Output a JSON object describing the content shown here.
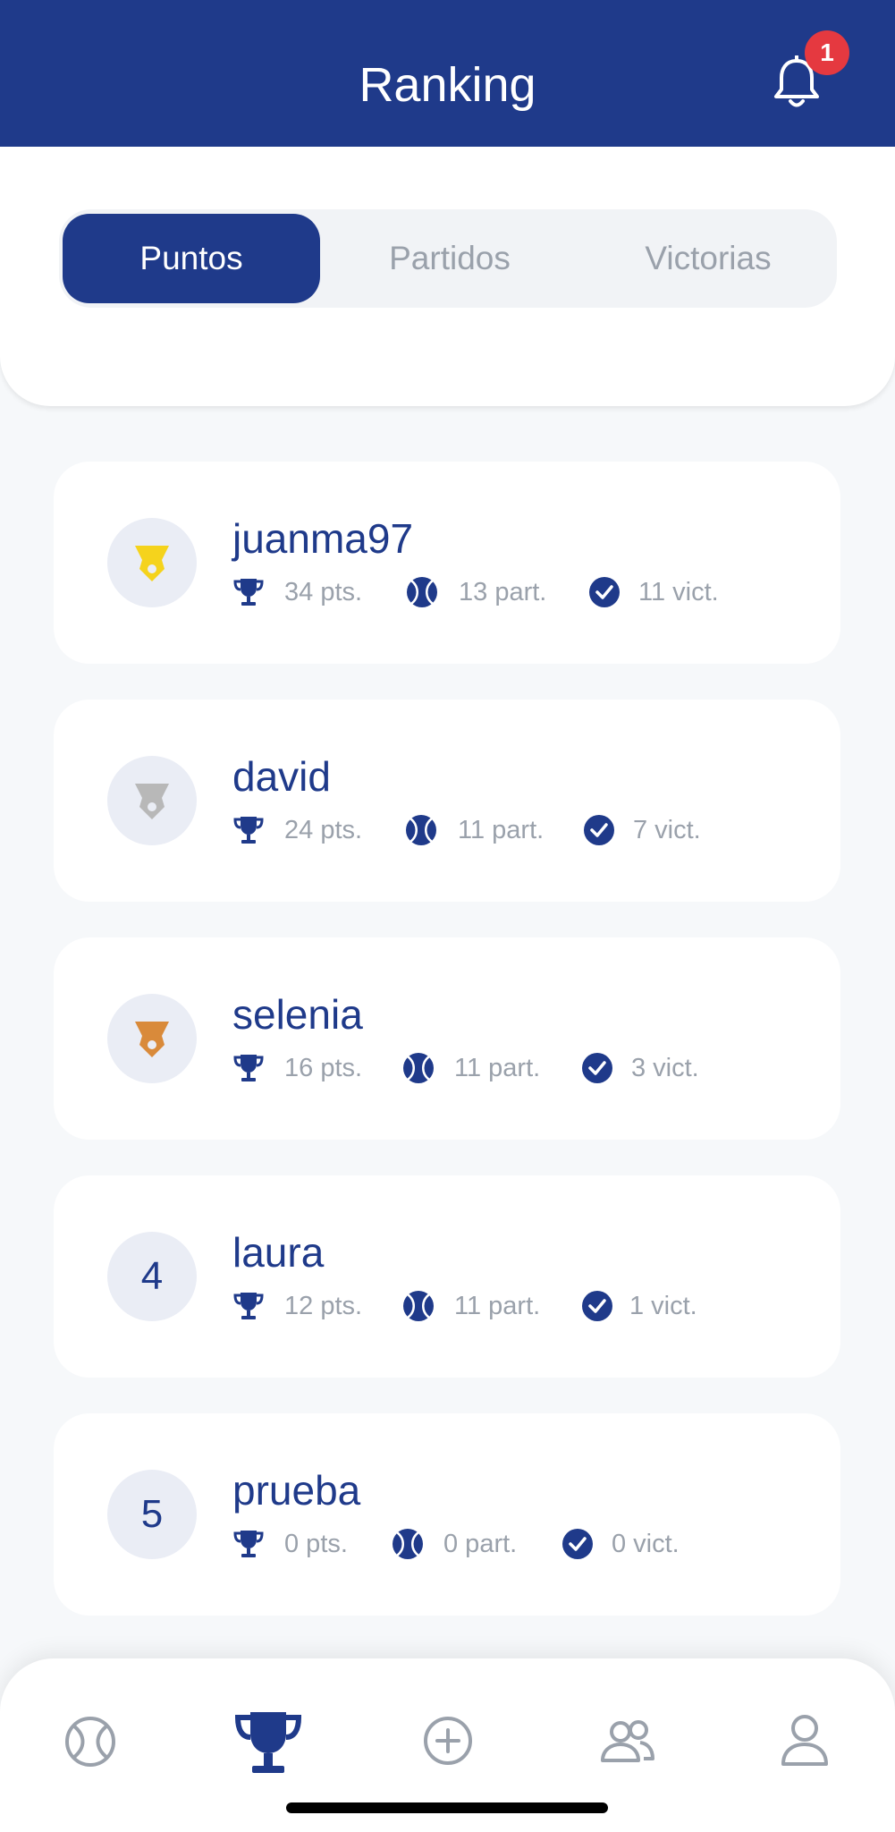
{
  "header": {
    "title": "Ranking",
    "notifications_count": "1"
  },
  "tabs": [
    {
      "label": "Puntos",
      "active": true
    },
    {
      "label": "Partidos",
      "active": false
    },
    {
      "label": "Victorias",
      "active": false
    }
  ],
  "ranking": [
    {
      "position": "1",
      "medal": "gold-medal-icon",
      "medal_color": "#f5d31c",
      "name": "juanma97",
      "points": "34 pts.",
      "matches": "13 part.",
      "wins": "11 vict."
    },
    {
      "position": "2",
      "medal": "silver-medal-icon",
      "medal_color": "#b8b8b8",
      "name": "david",
      "points": "24 pts.",
      "matches": "11 part.",
      "wins": "7 vict."
    },
    {
      "position": "3",
      "medal": "bronze-medal-icon",
      "medal_color": "#d98a3a",
      "name": "selenia",
      "points": "16 pts.",
      "matches": "11 part.",
      "wins": "3 vict."
    },
    {
      "position": "4",
      "medal": null,
      "name": "laura",
      "points": "12 pts.",
      "matches": "11 part.",
      "wins": "1 vict."
    },
    {
      "position": "5",
      "medal": null,
      "name": "prueba",
      "points": "0 pts.",
      "matches": "0 part.",
      "wins": "0 vict."
    }
  ],
  "bottom_nav": [
    {
      "icon": "tennis-ball-icon",
      "active": false
    },
    {
      "icon": "trophy-icon",
      "active": true
    },
    {
      "icon": "add-circle-icon",
      "active": false
    },
    {
      "icon": "users-icon",
      "active": false
    },
    {
      "icon": "profile-icon",
      "active": false
    }
  ],
  "colors": {
    "primary": "#1f3a8a",
    "muted": "#9aa1ab",
    "badge": "#e53940",
    "background": "#f6f8fa"
  }
}
